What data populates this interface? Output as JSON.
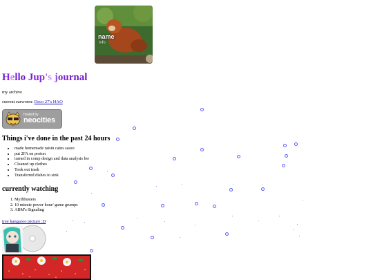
{
  "profile": {
    "name": "name",
    "info": "info"
  },
  "title": {
    "glow_part": "Hello",
    "rest": " Jup's journal"
  },
  "archive_text": "my archive",
  "earworm": {
    "label": "current earworm: ",
    "link": "Deco 27's HAO"
  },
  "neocities_badge": {
    "small": "hosted by",
    "big": "neocities"
  },
  "done": {
    "heading": "Things i've done in the past 24 hours",
    "items": [
      "made homemade raisin cains sauce",
      "put 2FA on proton",
      "turned in comp design and data analysis hw",
      "Cleaned up clothes",
      "Took out trash",
      "Transferred dishes to sink"
    ]
  },
  "watching": {
    "heading": "currently watching",
    "items": [
      "Mythbusters",
      "10 minute power hour/ game grumps",
      "ABM's Signaling"
    ]
  },
  "kangaroo_link": "tree kangaroo picture :D",
  "colors": {
    "title_purple": "#7a22d6",
    "link_blue": "#1a0dab",
    "bubble_blue": "#5a5aff"
  }
}
